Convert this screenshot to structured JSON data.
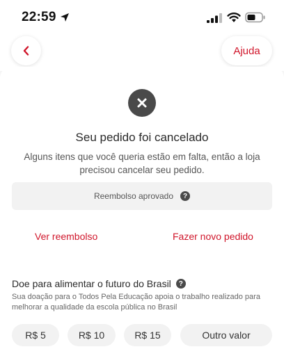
{
  "status_bar": {
    "time": "22:59"
  },
  "header": {
    "back_label": "‹",
    "help_label": "Ajuda"
  },
  "order": {
    "title": "Seu pedido foi cancelado",
    "subtitle": "Alguns itens que você queria estão em falta, então a loja precisou cancelar seu pedido.",
    "refund_status": "Reembolso aprovado"
  },
  "actions": {
    "view_refund": "Ver reembolso",
    "new_order": "Fazer novo pedido"
  },
  "donation": {
    "title": "Doe para alimentar o futuro do Brasil",
    "description": "Sua doação para o Todos Pela Educação apoia o trabalho realizado para melhorar a qualidade da escola pública no Brasil",
    "amounts": [
      "R$ 5",
      "R$ 10",
      "R$ 15",
      "Outro valor"
    ]
  },
  "colors": {
    "accent": "#d0152a",
    "icon_dark": "#4a4a4a",
    "chip_bg": "#f2f2f2"
  }
}
